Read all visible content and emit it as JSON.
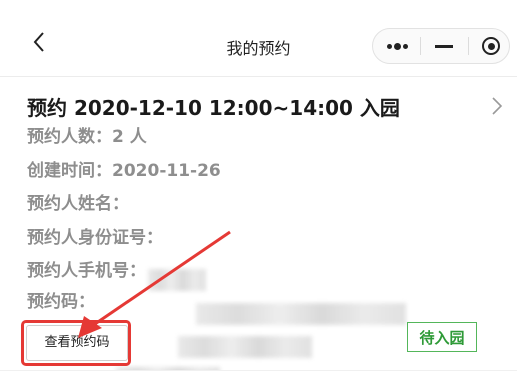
{
  "navbar": {
    "title": "我的预约",
    "back_icon": "chevron-left-icon",
    "more_icon": "more-dots-icon",
    "minimize_icon": "minimize-icon",
    "close_icon": "target-circle-icon"
  },
  "reservation": {
    "title": "预约 2020-12-10 12:00~14:00 入园",
    "count_label": "预约人数：",
    "count_value": "2 人",
    "created_label": "创建时间：",
    "created_value": "2020-11-26",
    "name_label": "预约人姓名：",
    "id_label": "预约人身份证号：",
    "phone_label": "预约人手机号：",
    "code_label": "预约码：",
    "view_code_button": "查看预约码",
    "status": "待入园"
  },
  "colors": {
    "annotation_red": "#e53935",
    "status_green": "#2e9a37",
    "label_gray": "#8e8e8e"
  }
}
